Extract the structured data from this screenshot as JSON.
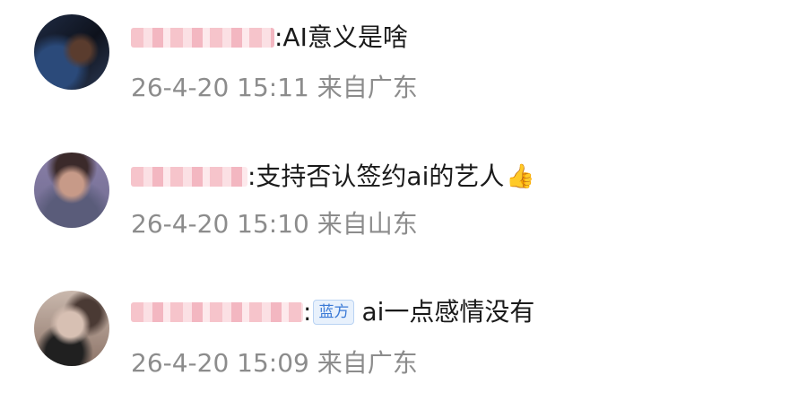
{
  "comments": [
    {
      "content": ":AI意义是啥",
      "badge": "",
      "emoji": "",
      "time": "26-4-20 15:11",
      "location": "来自广东"
    },
    {
      "content": ":支持否认签约ai的艺人",
      "badge": "",
      "emoji": "👍",
      "emoji_icon": "thumbs-up-icon",
      "time": "26-4-20 15:10",
      "location": "来自山东"
    },
    {
      "content_prefix": ":",
      "badge": "蓝方",
      "content": "ai一点感情没有",
      "emoji": "",
      "time": "26-4-20 15:09",
      "location": "来自广东"
    }
  ]
}
